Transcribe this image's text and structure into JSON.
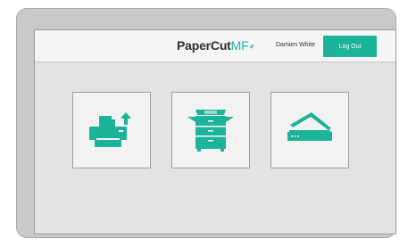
{
  "header": {
    "logo_main": "PaperCut",
    "logo_suffix": "MF",
    "user_name": "Damien White",
    "logout_label": "Log Out"
  },
  "tiles": [
    {
      "icon": "release-print-icon"
    },
    {
      "icon": "copier-icon"
    },
    {
      "icon": "scanner-icon"
    }
  ],
  "colors": {
    "accent": "#1bb39a",
    "bezel": "#c9c9c9",
    "screen_bg": "#e3e3e3",
    "header_bg": "#f5f5f5",
    "tile_bg": "#f2f2f2"
  }
}
